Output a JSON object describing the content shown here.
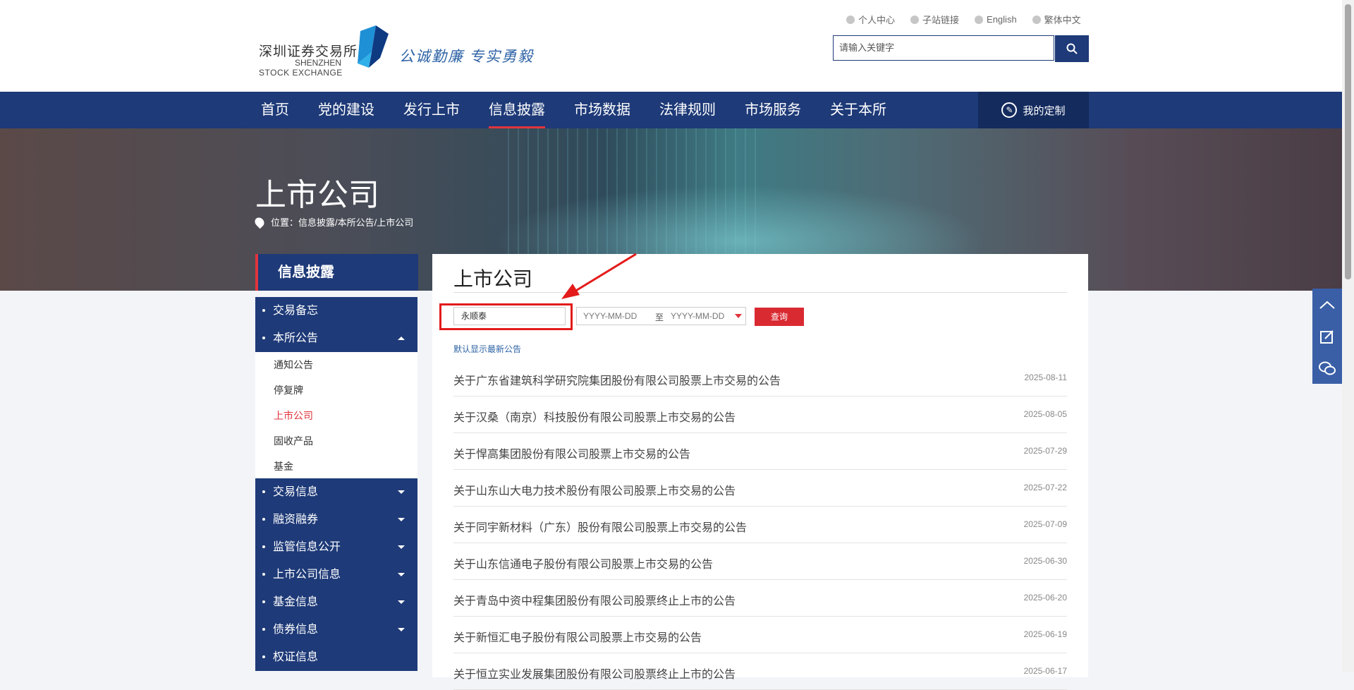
{
  "header": {
    "logo_cn": "深圳证券交易所",
    "logo_en_line1": "SHENZHEN",
    "logo_en_line2": "STOCK EXCHANGE",
    "slogan": "公诚勤廉 专实勇毅",
    "top_links": [
      "个人中心",
      "子站链接",
      "English",
      "繁体中文"
    ],
    "search_placeholder": "请输入关键字"
  },
  "nav": {
    "items": [
      "首页",
      "党的建设",
      "发行上市",
      "信息披露",
      "市场数据",
      "法律规则",
      "市场服务",
      "关于本所"
    ],
    "active": "信息披露",
    "custom_label": "我的定制"
  },
  "banner": {
    "title": "上市公司",
    "breadcrumb": "位置：信息披露/本所公告/上市公司"
  },
  "sidebar": {
    "header": "信息披露",
    "items": [
      {
        "label": "交易备忘",
        "expanded": false,
        "has_caret": false
      },
      {
        "label": "本所公告",
        "expanded": true,
        "has_caret": true
      },
      {
        "label": "交易信息",
        "expanded": false,
        "has_caret": true
      },
      {
        "label": "融资融券",
        "expanded": false,
        "has_caret": true
      },
      {
        "label": "监管信息公开",
        "expanded": false,
        "has_caret": true
      },
      {
        "label": "上市公司信息",
        "expanded": false,
        "has_caret": true
      },
      {
        "label": "基金信息",
        "expanded": false,
        "has_caret": true
      },
      {
        "label": "债券信息",
        "expanded": false,
        "has_caret": true
      },
      {
        "label": "权证信息",
        "expanded": false,
        "has_caret": false
      }
    ],
    "sub_items": [
      "通知公告",
      "停复牌",
      "上市公司",
      "固收产品",
      "基金"
    ],
    "active_sub": "上市公司"
  },
  "main": {
    "title": "上市公司",
    "keyword_value": "永顺泰",
    "date_start_placeholder": "YYYY-MM-DD",
    "date_to": "至",
    "date_end_placeholder": "YYYY-MM-DD",
    "query_label": "查询",
    "hint": "默认显示最新公告",
    "announcements": [
      {
        "title": "关于广东省建筑科学研究院集团股份有限公司股票上市交易的公告",
        "date": "2025-08-11"
      },
      {
        "title": "关于汉桑（南京）科技股份有限公司股票上市交易的公告",
        "date": "2025-08-05"
      },
      {
        "title": "关于悍高集团股份有限公司股票上市交易的公告",
        "date": "2025-07-29"
      },
      {
        "title": "关于山东山大电力技术股份有限公司股票上市交易的公告",
        "date": "2025-07-22"
      },
      {
        "title": "关于同宇新材料（广东）股份有限公司股票上市交易的公告",
        "date": "2025-07-09"
      },
      {
        "title": "关于山东信通电子股份有限公司股票上市交易的公告",
        "date": "2025-06-30"
      },
      {
        "title": "关于青岛中资中程集团股份有限公司股票终止上市的公告",
        "date": "2025-06-20"
      },
      {
        "title": "关于新恒汇电子股份有限公司股票上市交易的公告",
        "date": "2025-06-19"
      },
      {
        "title": "关于恒立实业发展集团股份有限公司股票终止上市的公告",
        "date": "2025-06-17"
      }
    ]
  },
  "float_bar": {
    "icons": [
      "back-to-top-icon",
      "feedback-icon",
      "wechat-icon"
    ],
    "color": "#3a5fa6"
  },
  "colors": {
    "brand_blue": "#1e3a78",
    "accent_red": "#e0343d",
    "annotation_red": "#e31b1b"
  }
}
